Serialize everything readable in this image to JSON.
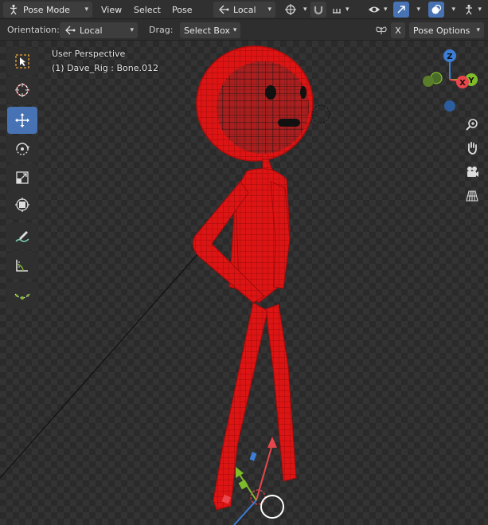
{
  "header": {
    "mode": "Pose Mode",
    "menu": [
      "View",
      "Select",
      "Pose"
    ],
    "transform_orientation": "Local"
  },
  "subheader": {
    "orientation_label": "Orientation:",
    "orientation_value": "Local",
    "drag_label": "Drag:",
    "drag_value": "Select Box",
    "x_mirror": "X",
    "pose_options": "Pose Options"
  },
  "viewport": {
    "perspective": "User Perspective",
    "object_info": "(1) Dave_Rig : Bone.012"
  },
  "toolbar": {
    "tools": [
      "select-box",
      "cursor",
      "move",
      "rotate",
      "scale",
      "transform",
      "annotate",
      "measure",
      "relax-pose"
    ],
    "active": "move"
  },
  "gizmo": {
    "axes": [
      "X",
      "Y",
      "Z"
    ],
    "colors": {
      "x": "#e8464c",
      "y": "#7fbc2a",
      "z": "#3c7dd6"
    }
  },
  "colors": {
    "accent": "#4772b3",
    "bone": "#e01616"
  }
}
